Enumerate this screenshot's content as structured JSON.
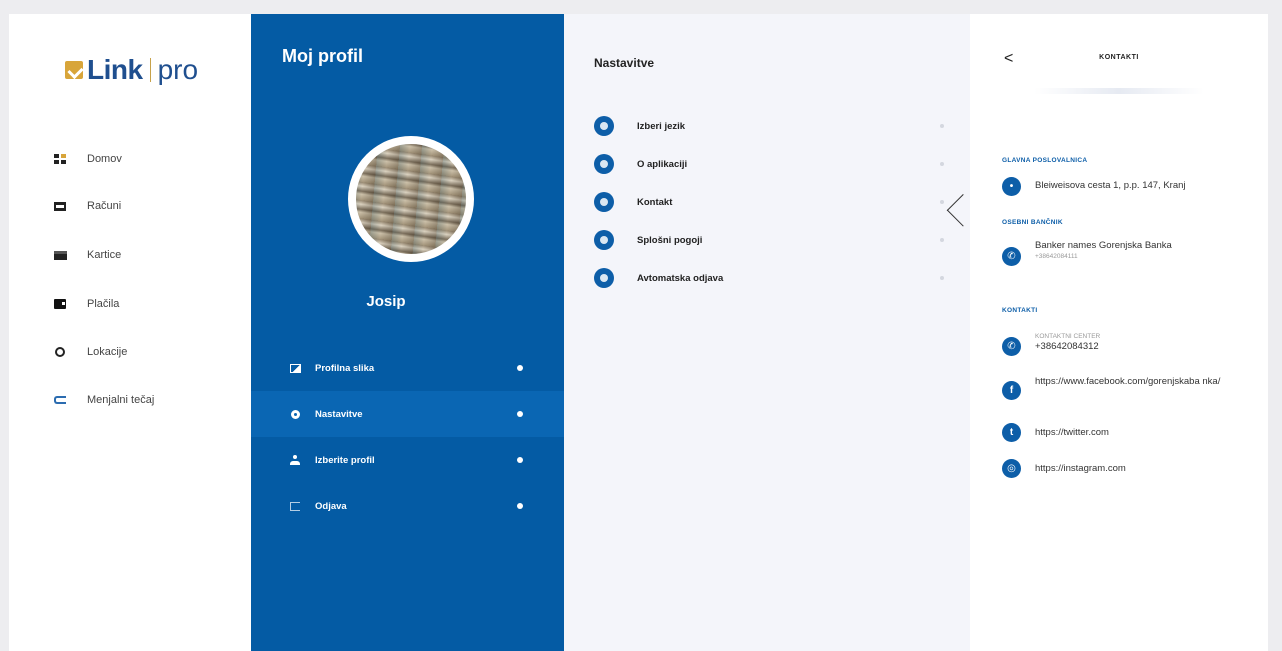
{
  "nav": {
    "logo": {
      "link": "Link",
      "pro": "pro"
    },
    "items": [
      {
        "label": "Domov",
        "icon": "home-grid-icon"
      },
      {
        "label": "Računi",
        "icon": "accounts-icon"
      },
      {
        "label": "Kartice",
        "icon": "card-icon"
      },
      {
        "label": "Plačila",
        "icon": "wallet-icon"
      },
      {
        "label": "Lokacije",
        "icon": "location-icon"
      },
      {
        "label": "Menjalni tečaj",
        "icon": "exchange-icon"
      }
    ]
  },
  "profile": {
    "title": "Moj profil",
    "name": "Josip",
    "menu": [
      {
        "label": "Profilna slika",
        "icon": "image-icon"
      },
      {
        "label": "Nastavitve",
        "icon": "gear-icon",
        "active": true
      },
      {
        "label": "Izberite profil",
        "icon": "user-icon"
      },
      {
        "label": "Odjava",
        "icon": "logout-icon"
      }
    ]
  },
  "settings": {
    "title": "Nastavitve",
    "items": [
      {
        "label": "Izberi jezik"
      },
      {
        "label": "O aplikaciji"
      },
      {
        "label": "Kontakt"
      },
      {
        "label": "Splošni pogoji"
      },
      {
        "label": "Avtomatska odjava"
      }
    ]
  },
  "contacts": {
    "title": "KONTAKTI",
    "sections": {
      "main_office": "GLAVNA POSLOVALNICA",
      "banker": "OSEBNI BANČNIK",
      "contacts": "KONTAKTI"
    },
    "address": "Bleiweisova cesta 1, p.p. 147, Kranj",
    "banker_name": "Banker names Gorenjska Banka",
    "banker_phone": "+38642084111",
    "contact_center_label": "KONTAKTNI CENTER",
    "contact_center_phone": "+38642084312",
    "facebook": "https://www.facebook.com/gorenjskaba nka/",
    "twitter": "https://twitter.com",
    "instagram": "https://instagram.com"
  },
  "colors": {
    "primary_blue": "#045ba4",
    "accent_gold": "#d8a53a",
    "panel_bg": "#f4f5fa"
  }
}
